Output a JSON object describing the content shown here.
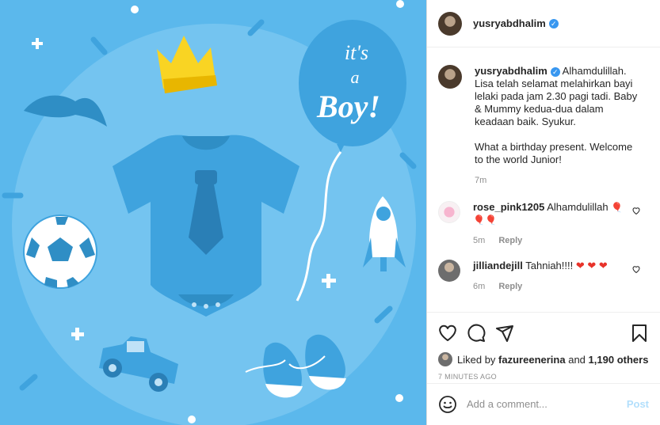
{
  "image": {
    "balloon_line1": "it's",
    "balloon_line2": "a",
    "balloon_line3": "Boy!"
  },
  "post": {
    "author": "yusryabdhalim",
    "caption": {
      "username": "yusryabdhalim",
      "para1": "Alhamdulillah. Lisa telah selamat melahirkan bayi lelaki pada jam 2.30 pagi tadi. Baby & Mummy kedua-dua dalam keadaan baik. Syukur.",
      "para2": "What a birthday present. Welcome to the world Junior!",
      "time": "7m"
    },
    "comments": [
      {
        "username": "rose_pink1205",
        "text": "Alhamdulillah",
        "emoji": "🎈 🎈🎈",
        "time": "5m",
        "reply": "Reply"
      },
      {
        "username": "jilliandejill",
        "text": "Tahniah!!!!",
        "emoji": "❤ ❤ ❤",
        "time": "6m",
        "reply": "Reply"
      }
    ],
    "likes": {
      "prefix": "Liked by",
      "user": "fazureenerina",
      "and": "and",
      "count": "1,190 others"
    },
    "timestamp": "7 MINUTES AGO"
  },
  "add_comment": {
    "placeholder": "Add a comment...",
    "post_label": "Post"
  },
  "colors": {
    "background": "#5bb8ec",
    "verified": "#3897f0",
    "post_button": "#b2dffc"
  }
}
